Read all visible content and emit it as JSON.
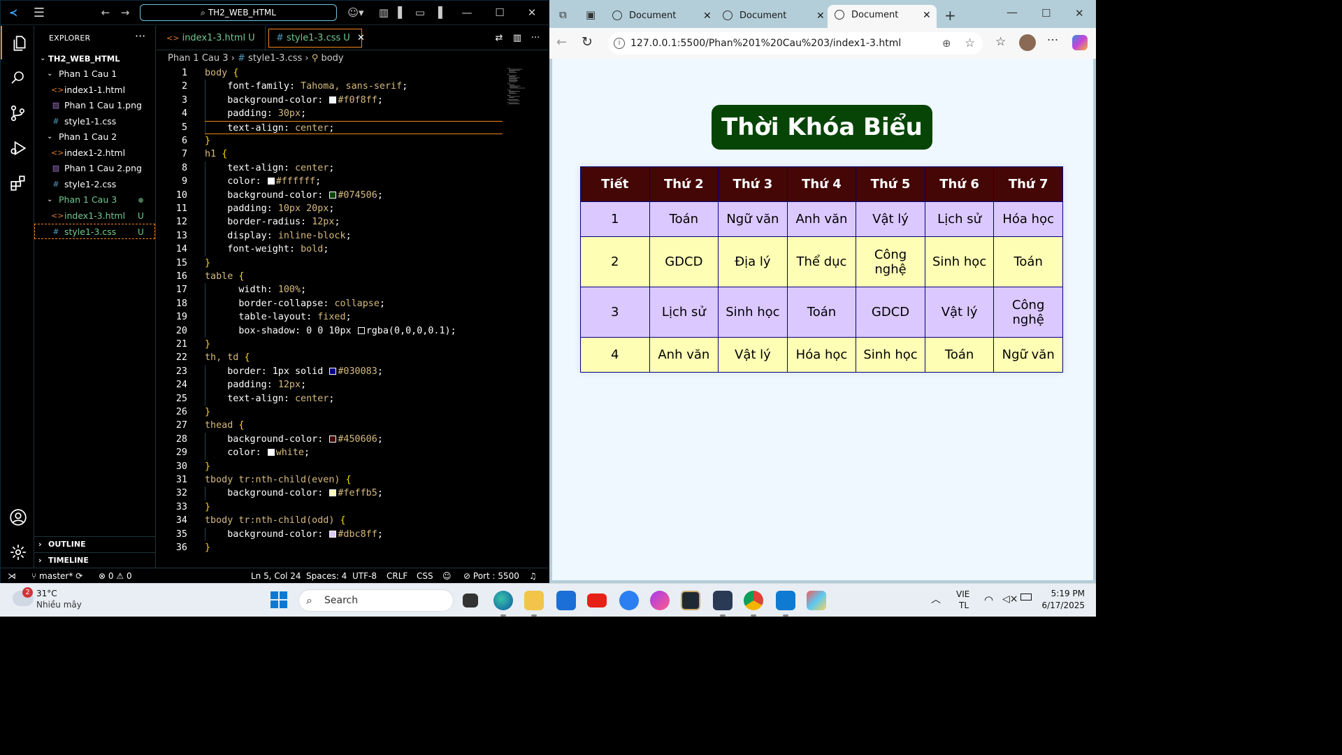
{
  "vscode": {
    "command_center": "TH2_WEB_HTML",
    "explorer_title": "EXPLORER",
    "workspace": "TH2_WEB_HTML",
    "tree": [
      {
        "label": "Phan 1 Cau 1",
        "type": "folder"
      },
      {
        "label": "index1-1.html",
        "type": "html"
      },
      {
        "label": "Phan 1 Cau 1.png",
        "type": "png"
      },
      {
        "label": "style1-1.css",
        "type": "css"
      },
      {
        "label": "Phan 1 Cau 2",
        "type": "folder"
      },
      {
        "label": "index1-2.html",
        "type": "html"
      },
      {
        "label": "Phan 1 Cau 2.png",
        "type": "png"
      },
      {
        "label": "style1-2.css",
        "type": "css"
      },
      {
        "label": "Phan 1 Cau 3",
        "type": "folder"
      },
      {
        "label": "index1-3.html",
        "type": "html",
        "badge": "U"
      },
      {
        "label": "style1-3.css",
        "type": "css",
        "badge": "U"
      }
    ],
    "outline_label": "OUTLINE",
    "timeline_label": "TIMELINE",
    "tabs": [
      {
        "label": "index1-3.html",
        "badge": "U"
      },
      {
        "label": "style1-3.css",
        "badge": "U"
      }
    ],
    "breadcrumb": {
      "folder": "Phan 1 Cau 3",
      "file": "style1-3.css",
      "symbol": "body"
    },
    "code_lines": [
      "body {",
      "    font-family: Tahoma, sans-serif;",
      "    background-color: #f0f8ff;",
      "    padding: 30px;",
      "    text-align: center;",
      "}",
      "h1 {",
      "    text-align: center;",
      "    color: #ffffff;",
      "    background-color: #074506;",
      "    padding: 10px 20px;",
      "    border-radius: 12px;",
      "    display: inline-block;",
      "    font-weight: bold;",
      "}",
      "table {",
      "      width: 100%;",
      "      border-collapse: collapse;",
      "      table-layout: fixed;",
      "      box-shadow: 0 0 10px rgba(0,0,0,0.1);",
      "}",
      "th, td {",
      "    border: 1px solid #030083;",
      "    padding: 12px;",
      "    text-align: center;",
      "}",
      "thead {",
      "    background-color: #450606;",
      "    color: white;",
      "}",
      "tbody tr:nth-child(even) {",
      "    background-color: #feffb5;",
      "}",
      "tbody tr:nth-child(odd) {",
      "    background-color: #dbc8ff;",
      "}"
    ],
    "current_line": 5,
    "status": {
      "branch": "master*",
      "errors": "0",
      "warnings": "0",
      "position": "Ln 5, Col 24",
      "spaces": "Spaces: 4",
      "encoding": "UTF-8",
      "eol": "CRLF",
      "language": "CSS",
      "port": "Port : 5500"
    }
  },
  "browser": {
    "tabs": [
      "Document",
      "Document",
      "Document"
    ],
    "url": "127.0.0.1:5500/Phan%201%20Cau%203/index1-3.html",
    "page": {
      "heading": "Thời Khóa Biểu",
      "headers": [
        "Tiết",
        "Thứ 2",
        "Thứ 3",
        "Thứ 4",
        "Thứ 5",
        "Thứ 6",
        "Thứ 7"
      ],
      "rows": [
        [
          "1",
          "Toán",
          "Ngữ văn",
          "Anh văn",
          "Vật lý",
          "Lịch sử",
          "Hóa học"
        ],
        [
          "2",
          "GDCD",
          "Địa lý",
          "Thể dục",
          "Công nghệ",
          "Sinh học",
          "Toán"
        ],
        [
          "3",
          "Lịch sử",
          "Sinh học",
          "Toán",
          "GDCD",
          "Vật lý",
          "Công nghệ"
        ],
        [
          "4",
          "Anh văn",
          "Vật lý",
          "Hóa học",
          "Sinh học",
          "Toán",
          "Ngữ văn"
        ]
      ]
    }
  },
  "taskbar": {
    "weather_temp": "31°C",
    "weather_desc": "Nhiều mây",
    "weather_badge": "2",
    "search_label": "Search",
    "lang_top": "VIE",
    "lang_bottom": "TL",
    "time": "5:19 PM",
    "date": "6/17/2025"
  },
  "colors": {
    "vscode_accent": "#f38518",
    "hc_border": "#6fc3df",
    "h1_bg": "#074506",
    "thead_bg": "#450606",
    "row_odd": "#dbc8ff",
    "row_even": "#feffb5",
    "page_bg": "#f0f8ff"
  }
}
